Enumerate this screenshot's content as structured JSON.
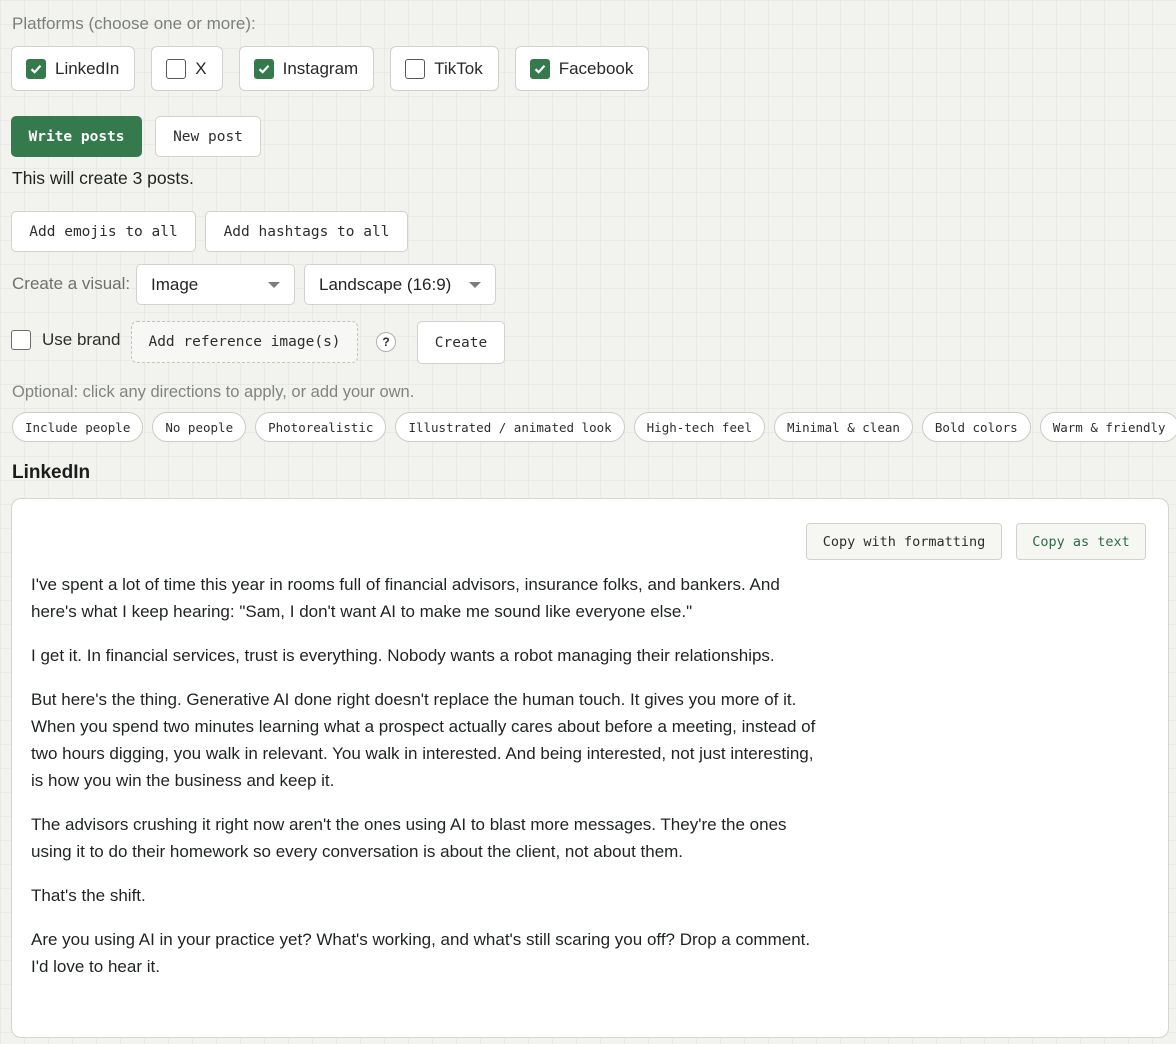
{
  "platforms": {
    "label": "Platforms (choose one or more):",
    "items": [
      {
        "label": "LinkedIn",
        "checked": true
      },
      {
        "label": "X",
        "checked": false
      },
      {
        "label": "Instagram",
        "checked": true
      },
      {
        "label": "TikTok",
        "checked": false
      },
      {
        "label": "Facebook",
        "checked": true
      }
    ]
  },
  "actions": {
    "write_posts": "Write posts",
    "new_post": "New post",
    "info": "This will create 3 posts.",
    "add_emojis": "Add emojis to all",
    "add_hashtags": "Add hashtags to all"
  },
  "visual": {
    "label": "Create a visual:",
    "type_value": "Image",
    "aspect_value": "Landscape (16:9)",
    "use_brand_label": "Use brand",
    "use_brand_checked": false,
    "reference_button": "Add reference image(s)",
    "help": "?",
    "create_button": "Create"
  },
  "directions": {
    "label": "Optional: click any directions to apply, or add your own.",
    "chips": [
      "Include people",
      "No people",
      "Photorealistic",
      "Illustrated / animated look",
      "High-tech feel",
      "Minimal & clean",
      "Bold colors",
      "Warm & friendly"
    ]
  },
  "post": {
    "platform": "LinkedIn",
    "copy_formatting": "Copy with formatting",
    "copy_text": "Copy as text",
    "paragraphs": [
      "I've spent a lot of time this year in rooms full of financial advisors, insurance folks, and bankers. And here's what I keep hearing: \"Sam, I don't want AI to make me sound like everyone else.\"",
      "I get it. In financial services, trust is everything. Nobody wants a robot managing their relationships.",
      "But here's the thing. Generative AI done right doesn't replace the human touch. It gives you more of it. When you spend two minutes learning what a prospect actually cares about before a meeting, instead of two hours digging, you walk in relevant. You walk in interested. And being interested, not just interesting, is how you win the business and keep it.",
      "The advisors crushing it right now aren't the ones using AI to blast more messages. They're the ones using it to do their homework so every conversation is about the client, not about them.",
      "That's the shift.",
      "Are you using AI in your practice yet? What's working, and what's still scaring you off? Drop a comment. I'd love to hear it."
    ]
  },
  "colors": {
    "accent": "#357a4c",
    "background": "#f2f3ef"
  }
}
